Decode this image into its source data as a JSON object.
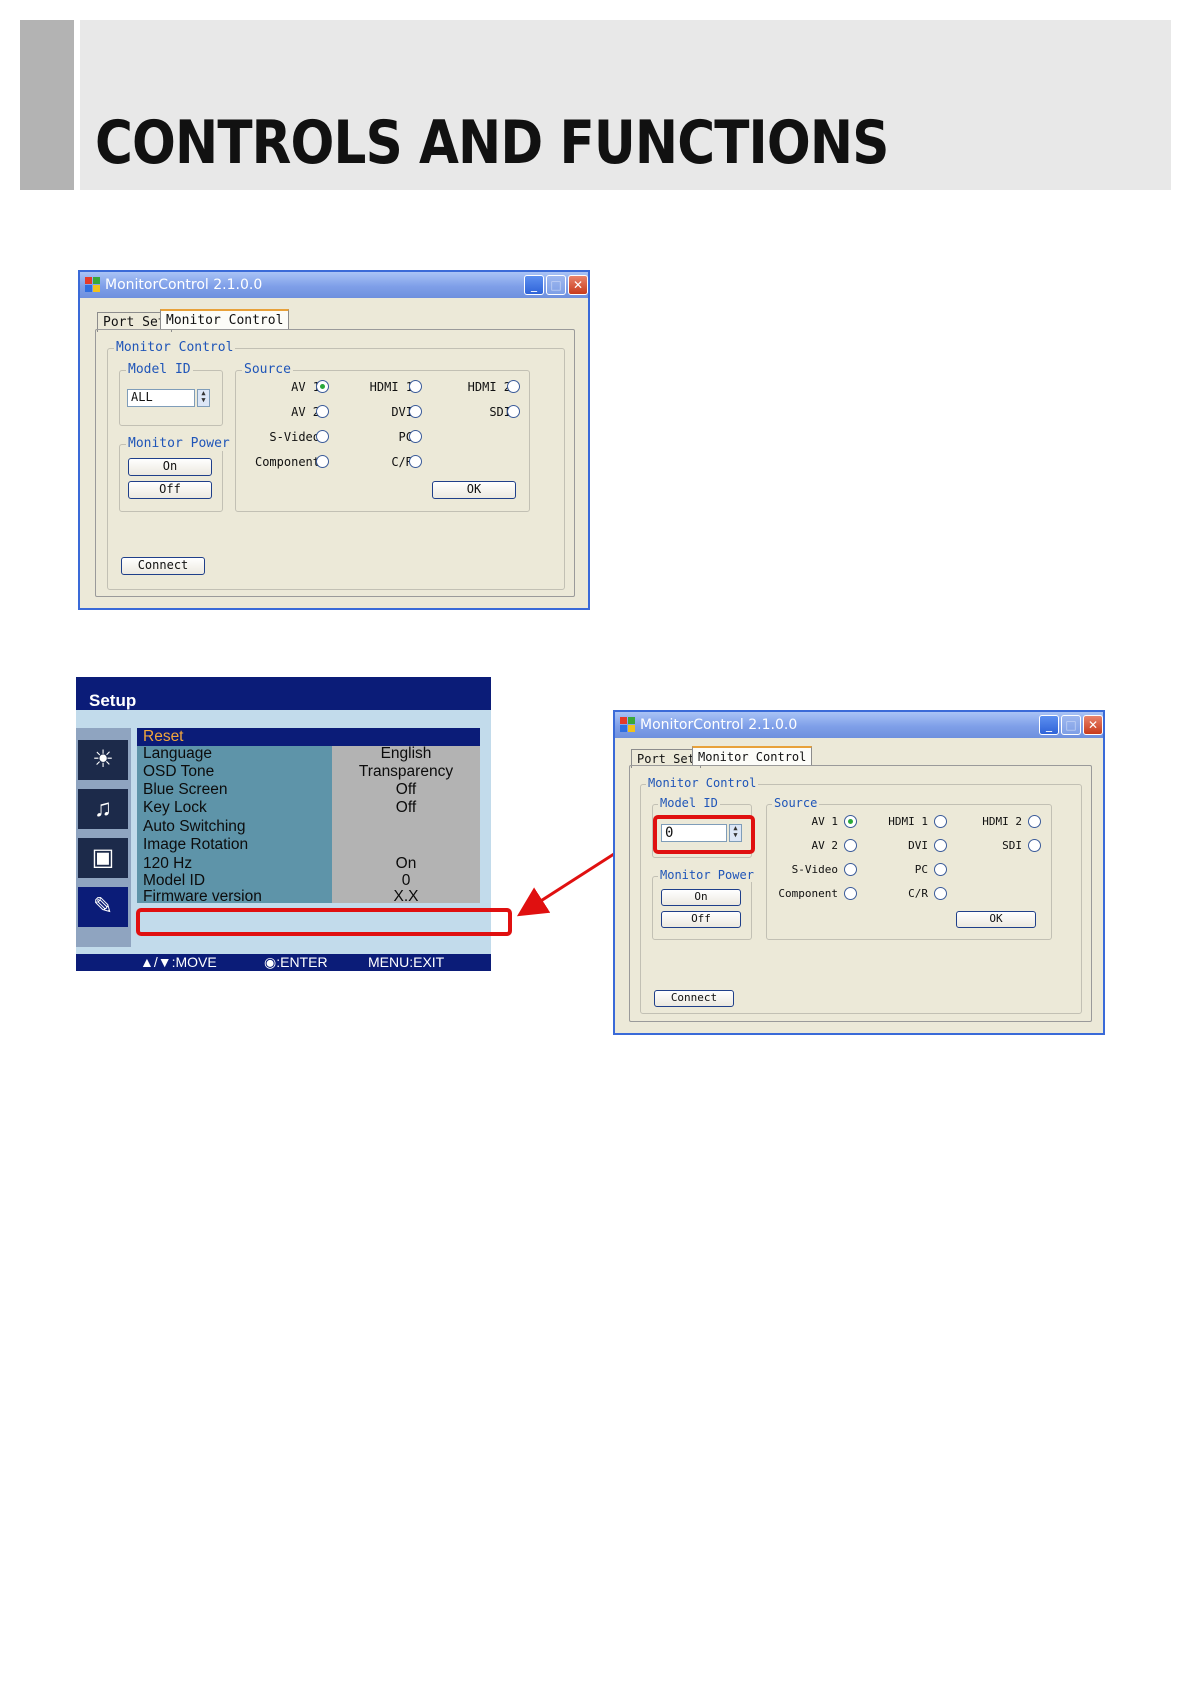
{
  "page": {
    "title": "CONTROLS AND FUNCTIONS"
  },
  "window": {
    "title": "MonitorControl  2.1.0.0",
    "tabs": [
      "Port Set",
      "Monitor Control"
    ],
    "group_monitor_control": "Monitor Control",
    "group_model_id": "Model ID",
    "group_monitor_power": "Monitor Power",
    "group_source": "Source",
    "power_on": "On",
    "power_off": "Off",
    "ok": "OK",
    "connect": "Connect",
    "sources": [
      {
        "label": "AV 1",
        "selected": true
      },
      {
        "label": "HDMI 1",
        "selected": false
      },
      {
        "label": "HDMI 2",
        "selected": false
      },
      {
        "label": "AV 2",
        "selected": false
      },
      {
        "label": "DVI",
        "selected": false
      },
      {
        "label": "SDI",
        "selected": false
      },
      {
        "label": "S-Video",
        "selected": false
      },
      {
        "label": "PC",
        "selected": false
      },
      {
        "label": "Component",
        "selected": false
      },
      {
        "label": "C/R",
        "selected": false
      }
    ]
  },
  "window1": {
    "model_id_value": "ALL"
  },
  "window2": {
    "model_id_value": "0"
  },
  "osd": {
    "title": "Setup",
    "rows": [
      {
        "label": "Reset",
        "value": ""
      },
      {
        "label": "Language",
        "value": "English"
      },
      {
        "label": "OSD Tone",
        "value": "Transparency"
      },
      {
        "label": "Blue Screen",
        "value": "Off"
      },
      {
        "label": "Key Lock",
        "value": "Off"
      },
      {
        "label": "Auto Switching",
        "value": ""
      },
      {
        "label": "Image Rotation",
        "value": ""
      },
      {
        "label": "120 Hz",
        "value": "On"
      },
      {
        "label": "Model ID",
        "value": "0"
      },
      {
        "label": "Firmware version",
        "value": "X.X"
      }
    ],
    "footer": {
      "move": "▲/▼:MOVE",
      "enter": "◉:ENTER",
      "exit": "MENU:EXIT"
    }
  },
  "colors": {
    "highlight": "#e01010",
    "osd_blue": "#0b1c78",
    "xp_title": "#7f9fe8"
  }
}
